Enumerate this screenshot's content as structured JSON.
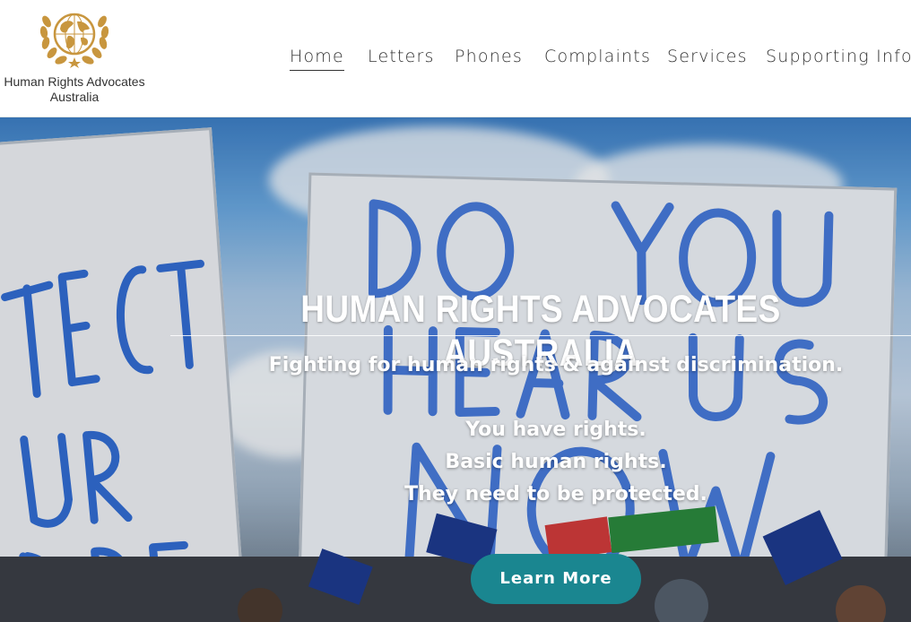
{
  "logo": {
    "line1": "Human Rights Advocates",
    "line2": "Australia",
    "icon": "globe-laurel-icon",
    "gold": "#c8963e"
  },
  "nav": {
    "items": [
      {
        "label": "Home",
        "active": true
      },
      {
        "label": "Letters",
        "active": false
      },
      {
        "label": "Phones",
        "active": false
      },
      {
        "label": "Complaints",
        "active": false
      },
      {
        "label": "Services",
        "active": false
      },
      {
        "label": "Supporting Info",
        "active": false
      }
    ]
  },
  "hero": {
    "title": "HUMAN RIGHTS ADVOCATES AUSTRALIA",
    "subtitle": "Fighting for human rights & against discrimination.",
    "lines": [
      "You have rights.",
      "Basic human rights.",
      "They need to be protected."
    ],
    "button_label": "Learn More",
    "button_color": "#1a8690",
    "sign_text": "DO YOU HEAR US NOW",
    "left_sign_text": "TECT UR DREN"
  }
}
